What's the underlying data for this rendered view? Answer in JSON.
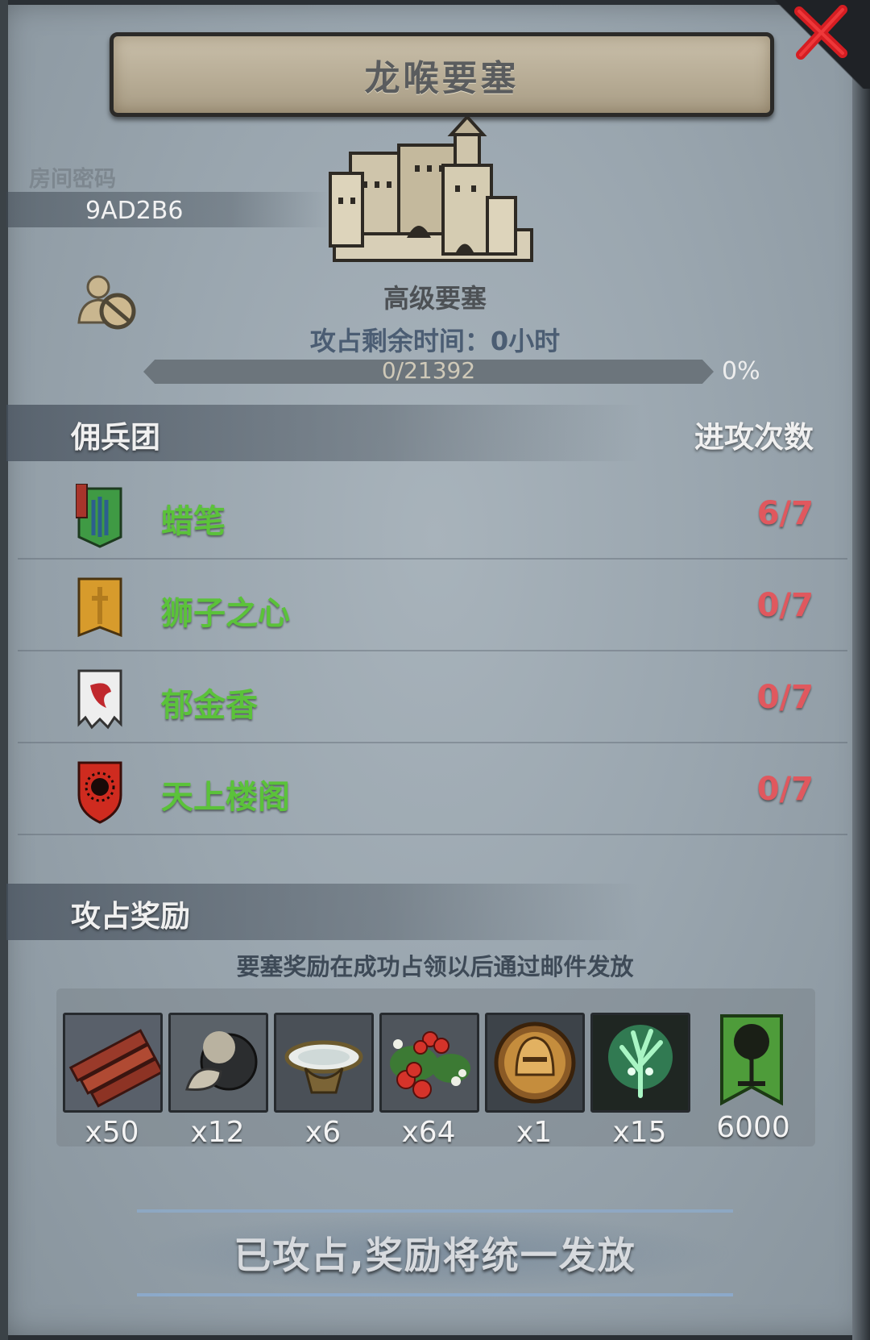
{
  "title": "龙喉要塞",
  "room": {
    "label": "房间密码",
    "code": "9AD2B6"
  },
  "fortress": {
    "type": "高级要塞",
    "time_remaining": "攻占剩余时间：0小时"
  },
  "progress": {
    "text": "0/21392",
    "percent_label": "0%",
    "fraction": 0
  },
  "mercenaries": {
    "title": "佣兵团",
    "attacks_title": "进攻次数",
    "rows": [
      {
        "name": "蜡笔",
        "count": "6/7",
        "banner": "green-wheat-banner-icon"
      },
      {
        "name": "狮子之心",
        "count": "0/7",
        "banner": "gold-sword-banner-icon"
      },
      {
        "name": "郁金香",
        "count": "0/7",
        "banner": "white-dragon-banner-icon"
      },
      {
        "name": "天上楼阁",
        "count": "0/7",
        "banner": "red-sun-shield-icon"
      }
    ]
  },
  "rewards": {
    "title": "攻占奖励",
    "notice": "要塞奖励在成功占领以后通过邮件发放",
    "items": [
      {
        "icon": "wood-logs-icon",
        "qty": "x50"
      },
      {
        "icon": "truffle-icon",
        "qty": "x12"
      },
      {
        "icon": "bowl-icon",
        "qty": "x6"
      },
      {
        "icon": "berries-icon",
        "qty": "x64"
      },
      {
        "icon": "knight-helmet-coin-icon",
        "qty": "x1"
      },
      {
        "icon": "green-spirit-tree-icon",
        "qty": "x15"
      },
      {
        "icon": "guild-tree-banner-icon",
        "qty": "6000"
      }
    ]
  },
  "bottom_status": "已攻占,奖励将统一发放",
  "colors": {
    "name_green": "#5bc23a",
    "count_red": "#e0585e"
  }
}
